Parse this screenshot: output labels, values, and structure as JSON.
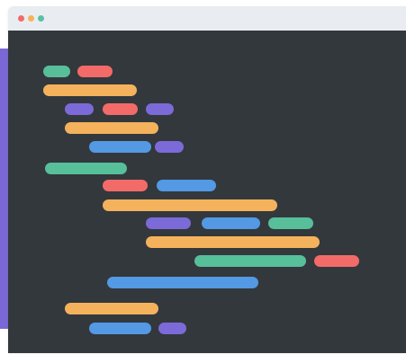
{
  "colors": {
    "background": "#ffffff",
    "accent_stripe": "#7b68d6",
    "titlebar": "#e9edf1",
    "editor_background": "#33383d",
    "dot_close": "#f26b68",
    "dot_minimize": "#f5b35a",
    "dot_maximize": "#59c1a5",
    "token_green": "#57bf9a",
    "token_red": "#f26b68",
    "token_orange": "#f4b25d",
    "token_purple": "#7c6ad8",
    "token_blue": "#5399e3"
  },
  "window": {
    "controls": [
      {
        "name": "close-dot",
        "icon": "close-dot",
        "color_key": "dot_close"
      },
      {
        "name": "minimize-dot",
        "icon": "minimize-dot",
        "color_key": "dot_minimize"
      },
      {
        "name": "maximize-dot",
        "icon": "maximize-dot",
        "color_key": "dot_maximize"
      }
    ]
  },
  "code_lines": [
    {
      "tokens": [
        "green",
        "red"
      ]
    },
    {
      "tokens": [
        "orange"
      ]
    },
    {
      "tokens": [
        "purple",
        "red",
        "purple"
      ]
    },
    {
      "tokens": [
        "orange"
      ]
    },
    {
      "tokens": [
        "blue",
        "purple"
      ]
    },
    {
      "tokens": [
        "green"
      ]
    },
    {
      "tokens": [
        "red",
        "blue"
      ]
    },
    {
      "tokens": [
        "orange"
      ]
    },
    {
      "tokens": [
        "purple",
        "blue",
        "green"
      ]
    },
    {
      "tokens": [
        "orange"
      ]
    },
    {
      "tokens": [
        "green",
        "red"
      ]
    },
    {
      "tokens": [
        "blue"
      ]
    },
    {
      "tokens": [
        "orange"
      ]
    },
    {
      "tokens": [
        "blue",
        "purple"
      ]
    }
  ]
}
